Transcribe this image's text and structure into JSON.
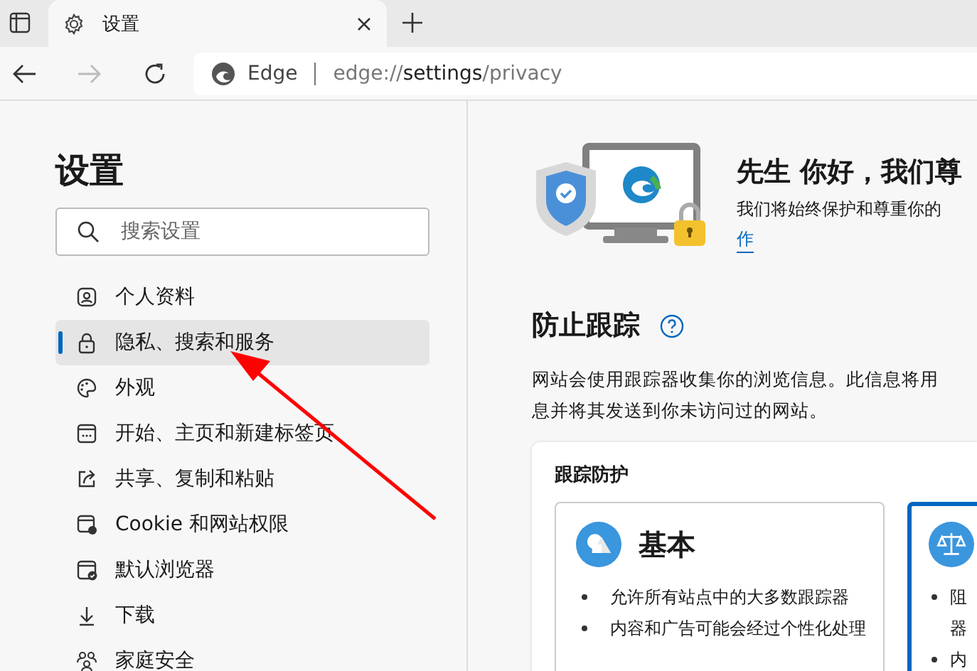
{
  "tabs": [
    {
      "title": "设置",
      "selected": true
    }
  ],
  "address_bar": {
    "site_label": "Edge",
    "url_prefix": "edge://",
    "url_host": "settings",
    "url_path": "/privacy"
  },
  "sidebar": {
    "title": "设置",
    "search": {
      "placeholder": "搜索设置"
    },
    "items": [
      {
        "label": "个人资料",
        "selected": false
      },
      {
        "label": "隐私、搜索和服务",
        "selected": true
      },
      {
        "label": "外观",
        "selected": false
      },
      {
        "label": "开始、主页和新建标签页",
        "selected": false
      },
      {
        "label": "共享、复制和粘贴",
        "selected": false
      },
      {
        "label": "Cookie 和网站权限",
        "selected": false
      },
      {
        "label": "默认浏览器",
        "selected": false
      },
      {
        "label": "下载",
        "selected": false
      },
      {
        "label": "家庭安全",
        "selected": false
      }
    ]
  },
  "banner": {
    "title": "先生 你好，我们尊",
    "subtitle": "我们将始终保护和尊重你的",
    "link": "作"
  },
  "tracking": {
    "title": "防止跟踪",
    "description_lines": [
      "网站会使用跟踪器收集你的浏览信息。此信息将用",
      "息并将其发送到你未访问过的网站。"
    ],
    "panel_title": "跟踪防护",
    "options": [
      {
        "title": "基本",
        "selected": false,
        "bullets": [
          [
            "允许所有站点中的大多数跟踪器"
          ],
          [
            "内容和广告可能会经过个性化处理"
          ]
        ]
      },
      {
        "selected": true,
        "bullets": [
          [
            "阻",
            "器"
          ],
          [
            "内"
          ]
        ]
      }
    ]
  },
  "annotation": {
    "kind": "arrow"
  }
}
